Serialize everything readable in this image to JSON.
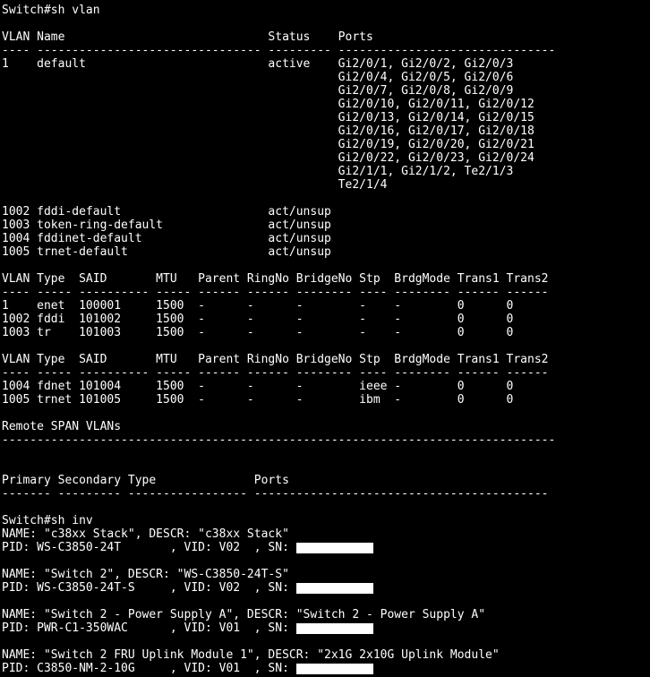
{
  "terminal": {
    "hostname": "Switch",
    "prompt_symbol": "#",
    "background_color": "#000000",
    "text_color": "#ffffff",
    "redaction_color": "#ffffff"
  },
  "command_1": {
    "prompt_line": "Switch#sh vlan",
    "command": "sh vlan"
  },
  "vlan_table": {
    "headers": [
      "VLAN",
      "Name",
      "Status",
      "Ports"
    ],
    "header_line": "VLAN Name                             Status    Ports",
    "separator_line": "---- -------------------------------- --------- -------------------------------",
    "rows": [
      {
        "vlan": "1",
        "name": "default",
        "status": "active",
        "ports": [
          "Gi2/0/1, Gi2/0/2, Gi2/0/3",
          "Gi2/0/4, Gi2/0/5, Gi2/0/6",
          "Gi2/0/7, Gi2/0/8, Gi2/0/9",
          "Gi2/0/10, Gi2/0/11, Gi2/0/12",
          "Gi2/0/13, Gi2/0/14, Gi2/0/15",
          "Gi2/0/16, Gi2/0/17, Gi2/0/18",
          "Gi2/0/19, Gi2/0/20, Gi2/0/21",
          "Gi2/0/22, Gi2/0/23, Gi2/0/24",
          "Gi2/1/1, Gi2/1/2, Te2/1/3",
          "Te2/1/4"
        ]
      },
      {
        "vlan": "1002",
        "name": "fddi-default",
        "status": "act/unsup",
        "ports": []
      },
      {
        "vlan": "1003",
        "name": "token-ring-default",
        "status": "act/unsup",
        "ports": []
      },
      {
        "vlan": "1004",
        "name": "fddinet-default",
        "status": "act/unsup",
        "ports": []
      },
      {
        "vlan": "1005",
        "name": "trnet-default",
        "status": "act/unsup",
        "ports": []
      }
    ],
    "rendered_lines": [
      "1    default                          active    Gi2/0/1, Gi2/0/2, Gi2/0/3",
      "                                                Gi2/0/4, Gi2/0/5, Gi2/0/6",
      "                                                Gi2/0/7, Gi2/0/8, Gi2/0/9",
      "                                                Gi2/0/10, Gi2/0/11, Gi2/0/12",
      "                                                Gi2/0/13, Gi2/0/14, Gi2/0/15",
      "                                                Gi2/0/16, Gi2/0/17, Gi2/0/18",
      "                                                Gi2/0/19, Gi2/0/20, Gi2/0/21",
      "                                                Gi2/0/22, Gi2/0/23, Gi2/0/24",
      "                                                Gi2/1/1, Gi2/1/2, Te2/1/3",
      "                                                Te2/1/4",
      "1002 fddi-default                     act/unsup",
      "1003 token-ring-default               act/unsup",
      "1004 fddinet-default                  act/unsup",
      "1005 trnet-default                    act/unsup"
    ]
  },
  "vlan_detail_table_1": {
    "headers": [
      "VLAN",
      "Type",
      "SAID",
      "MTU",
      "Parent",
      "RingNo",
      "BridgeNo",
      "Stp",
      "BrdgMode",
      "Trans1",
      "Trans2"
    ],
    "header_line": "VLAN Type  SAID       MTU   Parent RingNo BridgeNo Stp  BrdgMode Trans1 Trans2",
    "separator_line": "---- ----- ---------- ----- ------ ------ -------- ---- -------- ------ ------",
    "rows": [
      {
        "vlan": "1",
        "type": "enet",
        "said": "100001",
        "mtu": "1500",
        "parent": "-",
        "ringno": "-",
        "bridgeno": "-",
        "stp": "-",
        "brdgmode": "-",
        "trans1": "0",
        "trans2": "0"
      },
      {
        "vlan": "1002",
        "type": "fddi",
        "said": "101002",
        "mtu": "1500",
        "parent": "-",
        "ringno": "-",
        "bridgeno": "-",
        "stp": "-",
        "brdgmode": "-",
        "trans1": "0",
        "trans2": "0"
      },
      {
        "vlan": "1003",
        "type": "tr",
        "said": "101003",
        "mtu": "1500",
        "parent": "-",
        "ringno": "-",
        "bridgeno": "-",
        "stp": "-",
        "brdgmode": "-",
        "trans1": "0",
        "trans2": "0"
      }
    ],
    "rendered_lines": [
      "1    enet  100001     1500  -      -      -        -    -        0      0",
      "1002 fddi  101002     1500  -      -      -        -    -        0      0",
      "1003 tr    101003     1500  -      -      -        -    -        0      0"
    ]
  },
  "vlan_detail_table_2": {
    "headers": [
      "VLAN",
      "Type",
      "SAID",
      "MTU",
      "Parent",
      "RingNo",
      "BridgeNo",
      "Stp",
      "BrdgMode",
      "Trans1",
      "Trans2"
    ],
    "header_line": "VLAN Type  SAID       MTU   Parent RingNo BridgeNo Stp  BrdgMode Trans1 Trans2",
    "separator_line": "---- ----- ---------- ----- ------ ------ -------- ---- -------- ------ ------",
    "rows": [
      {
        "vlan": "1004",
        "type": "fdnet",
        "said": "101004",
        "mtu": "1500",
        "parent": "-",
        "ringno": "-",
        "bridgeno": "-",
        "stp": "ieee",
        "brdgmode": "-",
        "trans1": "0",
        "trans2": "0"
      },
      {
        "vlan": "1005",
        "type": "trnet",
        "said": "101005",
        "mtu": "1500",
        "parent": "-",
        "ringno": "-",
        "bridgeno": "-",
        "stp": "ibm",
        "brdgmode": "-",
        "trans1": "0",
        "trans2": "0"
      }
    ],
    "rendered_lines": [
      "1004 fdnet 101004     1500  -      -      -        ieee -        0      0",
      "1005 trnet 101005     1500  -      -      -        ibm  -        0      0"
    ]
  },
  "remote_span": {
    "title": "Remote SPAN VLANs",
    "separator_line": "-------------------------------------------------------------------------------",
    "value": ""
  },
  "private_vlan_table": {
    "headers": [
      "Primary",
      "Secondary",
      "Type",
      "Ports"
    ],
    "header_line": "Primary Secondary Type              Ports",
    "separator_line": "------- --------- ----------------- ------------------------------------------",
    "rows": []
  },
  "command_2": {
    "prompt_line": "Switch#sh inv",
    "command": "sh inv"
  },
  "inventory": {
    "entries": [
      {
        "name_line": "NAME: \"c38xx Stack\", DESCR: \"c38xx Stack\"",
        "name": "c38xx Stack",
        "descr": "c38xx Stack",
        "pid_prefix": "PID: WS-C3850-24T       , VID: V02  , SN: ",
        "pid": "WS-C3850-24T",
        "vid": "V02",
        "sn": "[REDACTED]",
        "sn_redacted": true,
        "sn_box_chars": 11
      },
      {
        "name_line": "NAME: \"Switch 2\", DESCR: \"WS-C3850-24T-S\"",
        "name": "Switch 2",
        "descr": "WS-C3850-24T-S",
        "pid_prefix": "PID: WS-C3850-24T-S     , VID: V02  , SN: ",
        "pid": "WS-C3850-24T-S",
        "vid": "V02",
        "sn": "[REDACTED]",
        "sn_redacted": true,
        "sn_box_chars": 11
      },
      {
        "name_line": "NAME: \"Switch 2 - Power Supply A\", DESCR: \"Switch 2 - Power Supply A\"",
        "name": "Switch 2 - Power Supply A",
        "descr": "Switch 2 - Power Supply A",
        "pid_prefix": "PID: PWR-C1-350WAC      , VID: V01  , SN: ",
        "pid": "PWR-C1-350WAC",
        "vid": "V01",
        "sn": "[REDACTED]",
        "sn_redacted": true,
        "sn_box_chars": 11
      },
      {
        "name_line": "NAME: \"Switch 2 FRU Uplink Module 1\", DESCR: \"2x1G 2x10G Uplink Module\"",
        "name": "Switch 2 FRU Uplink Module 1",
        "descr": "2x1G 2x10G Uplink Module",
        "pid_prefix": "PID: C3850-NM-2-10G     , VID: V01  , SN: ",
        "pid": "C3850-NM-2-10G",
        "vid": "V01",
        "sn": "[REDACTED]",
        "sn_redacted": true,
        "sn_box_chars": 11
      }
    ]
  }
}
